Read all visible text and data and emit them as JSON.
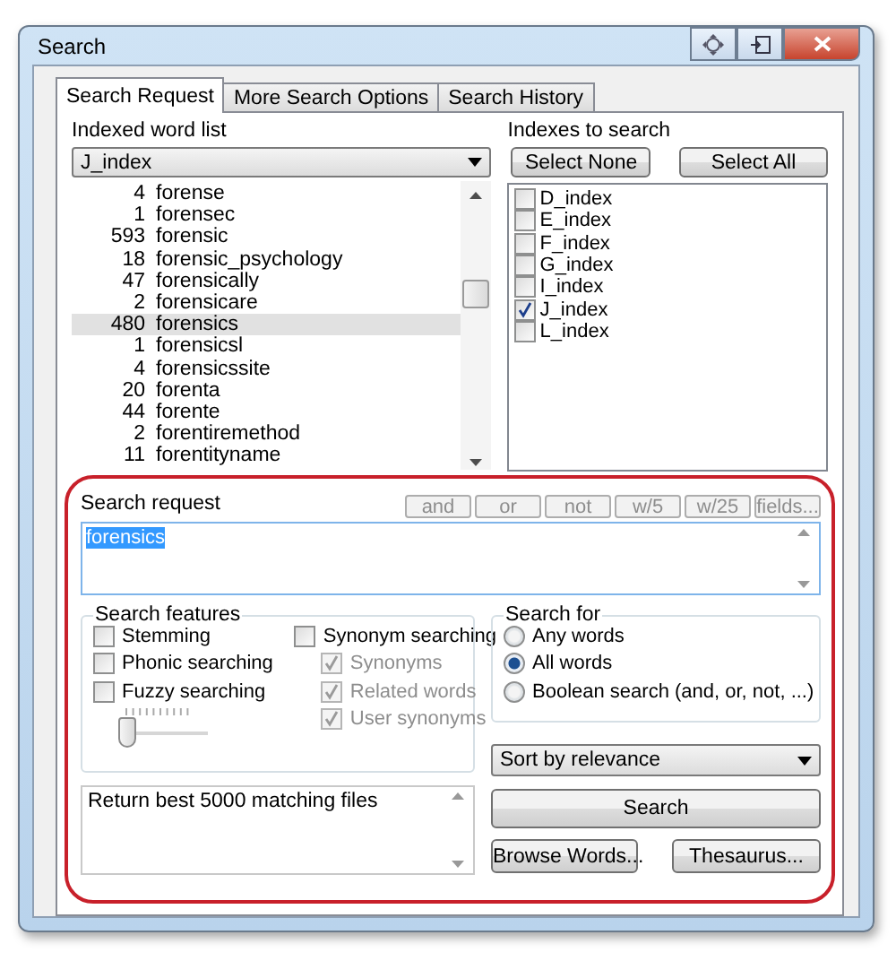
{
  "window": {
    "title": "Search"
  },
  "tabs": [
    {
      "label": "Search Request",
      "selected": true
    },
    {
      "label": "More Search Options",
      "selected": false
    },
    {
      "label": "Search History",
      "selected": false
    }
  ],
  "word_list": {
    "label": "Indexed word list",
    "combo_value": "J_index",
    "rows": [
      {
        "count": "4",
        "word": "forense",
        "selected": false
      },
      {
        "count": "1",
        "word": "forensec",
        "selected": false
      },
      {
        "count": "593",
        "word": "forensic",
        "selected": false
      },
      {
        "count": "18",
        "word": "forensic_psychology",
        "selected": false
      },
      {
        "count": "47",
        "word": "forensically",
        "selected": false
      },
      {
        "count": "2",
        "word": "forensicare",
        "selected": false
      },
      {
        "count": "480",
        "word": "forensics",
        "selected": true
      },
      {
        "count": "1",
        "word": "forensicsl",
        "selected": false
      },
      {
        "count": "4",
        "word": "forensicssite",
        "selected": false
      },
      {
        "count": "20",
        "word": "forenta",
        "selected": false
      },
      {
        "count": "44",
        "word": "forente",
        "selected": false
      },
      {
        "count": "2",
        "word": "forentiremethod",
        "selected": false
      },
      {
        "count": "11",
        "word": "forentityname",
        "selected": false
      }
    ]
  },
  "indexes": {
    "label": "Indexes to search",
    "buttons": [
      "Select None",
      "Select All"
    ],
    "items": [
      {
        "name": "D_index",
        "checked": false
      },
      {
        "name": "E_index",
        "checked": false
      },
      {
        "name": "F_index",
        "checked": false
      },
      {
        "name": "G_index",
        "checked": false
      },
      {
        "name": "I_index",
        "checked": false
      },
      {
        "name": "J_index",
        "checked": true
      },
      {
        "name": "L_index",
        "checked": false
      }
    ]
  },
  "search_request": {
    "label": "Search request",
    "value": "forensics",
    "operators": [
      {
        "label": "and",
        "disabled": true
      },
      {
        "label": "or",
        "disabled": true
      },
      {
        "label": "not",
        "disabled": true
      },
      {
        "label": "w/5",
        "disabled": true
      },
      {
        "label": "w/25",
        "disabled": true
      },
      {
        "label": "fields...",
        "disabled": true
      }
    ]
  },
  "search_features": {
    "title": "Search features",
    "options": [
      {
        "label": "Stemming",
        "checked": false
      },
      {
        "label": "Phonic searching",
        "checked": false
      },
      {
        "label": "Fuzzy searching",
        "checked": false
      }
    ],
    "fuzzy_slider": {
      "level": 0
    },
    "synonym": {
      "label": "Synonym searching",
      "checked": false
    },
    "synonym_options": [
      {
        "label": "Synonyms",
        "checked": true,
        "disabled": true
      },
      {
        "label": "Related words",
        "checked": true,
        "disabled": true
      },
      {
        "label": "User synonyms",
        "checked": true,
        "disabled": true
      }
    ]
  },
  "search_for": {
    "title": "Search for",
    "options": [
      {
        "label": "Any words",
        "selected": false
      },
      {
        "label": "All words",
        "selected": true
      },
      {
        "label": "Boolean search (and, or, not, ...)",
        "selected": false
      }
    ]
  },
  "sort": {
    "value": "Sort by relevance"
  },
  "results_note": "Return best 5000 matching files",
  "buttons": {
    "search": "Search",
    "browse": "Browse Words...",
    "thesaurus": "Thesaurus..."
  }
}
